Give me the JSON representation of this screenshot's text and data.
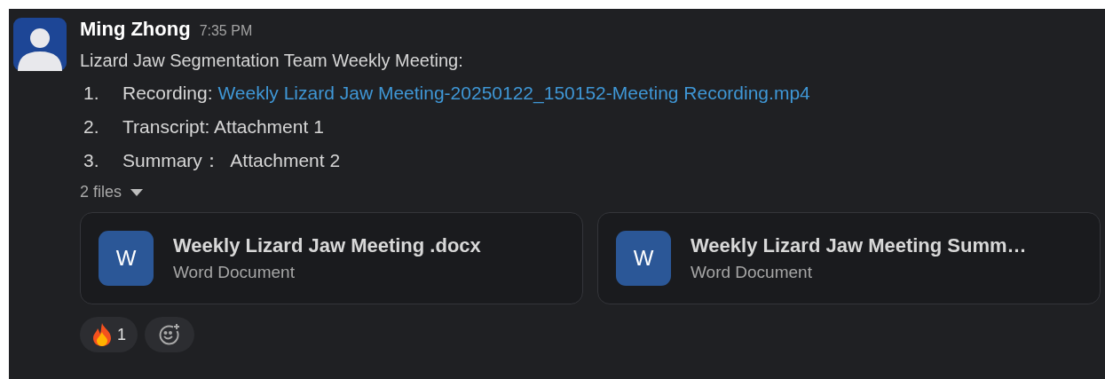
{
  "message": {
    "author": "Ming Zhong",
    "time": "7:35 PM",
    "intro": "Lizard Jaw Segmentation Team Weekly Meeting:",
    "items": [
      {
        "number": "1.",
        "label": "Recording: ",
        "link": "Weekly Lizard Jaw Meeting-20250122_150152-Meeting Recording.mp4"
      },
      {
        "number": "2.",
        "label": "Transcript: Attachment 1"
      },
      {
        "number": "3.",
        "label": "Summary：  Attachment 2"
      }
    ],
    "files_toggle": {
      "label": "2 files",
      "expanded": true
    },
    "files": [
      {
        "letter": "W",
        "name": "Weekly Lizard Jaw Meeting .docx",
        "type": "Word Document"
      },
      {
        "letter": "W",
        "name": "Weekly Lizard Jaw Meeting Summ…",
        "type": "Word Document"
      }
    ],
    "reactions": [
      {
        "kind": "fire",
        "count": "1"
      }
    ]
  }
}
